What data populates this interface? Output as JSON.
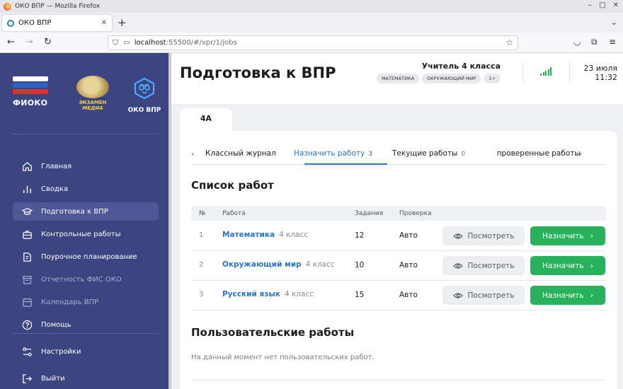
{
  "browser": {
    "window_title": "ОКО ВПР — Mozilla Firefox",
    "tab_title": "ОКО ВПР",
    "url_host": "localhost",
    "url_rest": ":55500/#/vpr/1/jobs"
  },
  "sidebar": {
    "logos": {
      "fioko": "ФИОКО",
      "exam_line1": "ЭКЗАМЕН",
      "exam_line2": "МЕДИА",
      "oko": "ОКО ВПР"
    },
    "items": [
      {
        "label": "Главная",
        "icon": "home-icon",
        "active": false,
        "disabled": false
      },
      {
        "label": "Сводка",
        "icon": "bar-chart-icon",
        "active": false,
        "disabled": false
      },
      {
        "label": "Подготовка к ВПР",
        "icon": "graduation-cap-icon",
        "active": true,
        "disabled": false
      },
      {
        "label": "Контрольные работы",
        "icon": "briefcase-icon",
        "active": false,
        "disabled": false
      },
      {
        "label": "Поурочное планирование",
        "icon": "edit-note-icon",
        "active": false,
        "disabled": false
      },
      {
        "label": "Отчетность ФИС ОКО",
        "icon": "archive-icon",
        "active": false,
        "disabled": true
      },
      {
        "label": "Календарь ВПР",
        "icon": "calendar-icon",
        "active": false,
        "disabled": true
      },
      {
        "label": "Помощь",
        "icon": "help-icon",
        "active": false,
        "disabled": false
      },
      {
        "label": "Настройки",
        "icon": "settings-icon",
        "active": false,
        "disabled": false
      },
      {
        "label": "Выйти",
        "icon": "logout-icon",
        "active": false,
        "disabled": false
      }
    ]
  },
  "header": {
    "title": "Подготовка к ВПР",
    "teacher": "Учитель 4 класса",
    "chips": [
      "МАТЕМАТИКА",
      "ОКРУЖАЮЩИЙ МИР",
      "1+"
    ],
    "date": "23 июля",
    "time": "11:32"
  },
  "class_tab": "4А",
  "subtabs": [
    {
      "label": "Классный журнал",
      "count": ""
    },
    {
      "label": "Назначить работу",
      "count": "3"
    },
    {
      "label": "Текущие работы",
      "count": "0"
    },
    {
      "label": "Не проверенные работы",
      "count": ""
    }
  ],
  "jobs": {
    "title": "Список работ",
    "columns": [
      "№",
      "Работа",
      "Задания",
      "Проверка"
    ],
    "view_label": "Посмотреть",
    "assign_label": "Назначить",
    "rows": [
      {
        "n": "1",
        "name": "Математика",
        "grade": "4 класс",
        "tasks": "12",
        "check": "Авто"
      },
      {
        "n": "2",
        "name": "Окружающий мир",
        "grade": "4 класс",
        "tasks": "10",
        "check": "Авто"
      },
      {
        "n": "3",
        "name": "Русский язык",
        "grade": "4 класс",
        "tasks": "15",
        "check": "Авто"
      }
    ]
  },
  "custom": {
    "title": "Пользовательские работы",
    "empty": "На данный момент нет пользовательских работ."
  },
  "colors": {
    "sidebar": "#3d4580",
    "accent": "#2d74c9",
    "assign": "#28b25c"
  }
}
